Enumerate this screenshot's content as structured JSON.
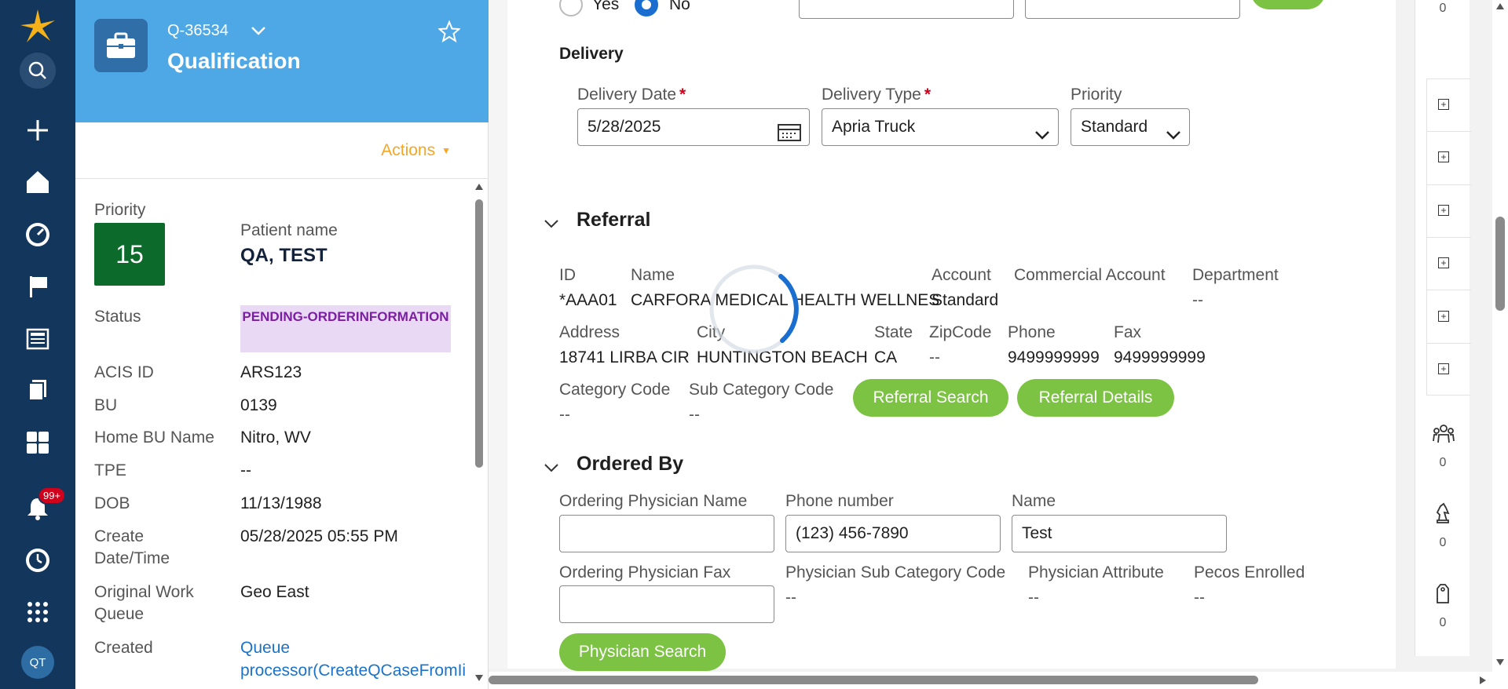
{
  "rail": {
    "notifications_badge": "99+",
    "avatar_initials": "QT",
    "icons": [
      "logo-icon",
      "search-icon",
      "plus-icon",
      "home-icon",
      "dashboard-icon",
      "flag-icon",
      "news-icon",
      "documents-icon",
      "apps-grid-icon",
      "bell-icon",
      "history-icon",
      "launcher-icon"
    ]
  },
  "case": {
    "id": "Q-36534",
    "title": "Qualification",
    "actions_label": "Actions",
    "fields": {
      "priority_label": "Priority",
      "priority_value": "15",
      "patient_name_label": "Patient name",
      "patient_name_value": "QA, TEST",
      "status_label": "Status",
      "status_value": "PENDING-ORDERINFORMATION",
      "acis_label": "ACIS ID",
      "acis_value": "ARS123",
      "bu_label": "BU",
      "bu_value": "0139",
      "home_bu_label": "Home BU Name",
      "home_bu_value": "Nitro, WV",
      "tpe_label": "TPE",
      "tpe_value": "--",
      "dob_label": "DOB",
      "dob_value": "11/13/1988",
      "create_label_1": "Create",
      "create_label_2": "Date/Time",
      "create_value": "05/28/2025 05:55 PM",
      "owq_label_1": "Original Work",
      "owq_label_2": "Queue",
      "owq_value": "Geo East",
      "created_label": "Created",
      "created_value_1": "Queue",
      "created_value_2": "processor(CreateQCaseFromIi"
    }
  },
  "main": {
    "radio_yes": "Yes",
    "radio_no": "No",
    "radio_selected": "No",
    "delivery": {
      "heading": "Delivery",
      "date_label": "Delivery Date",
      "date_value": "5/28/2025",
      "type_label": "Delivery Type",
      "type_value": "Apria Truck",
      "priority_label": "Priority",
      "priority_value": "Standard",
      "required_mark": "*"
    },
    "referral": {
      "heading": "Referral",
      "id_label": "ID",
      "id_value": "*AAA01",
      "name_label": "Name",
      "name_value": "CARFORA MEDICAL HEALTH WELLNES",
      "account_label": "Account",
      "account_value": "Standard",
      "commercial_label": "Commercial Account",
      "department_label": "Department",
      "department_value": "--",
      "address_label": "Address",
      "address_value": "18741 LIRBA CIR",
      "city_label": "City",
      "city_value": "HUNTINGTON BEACH",
      "state_label": "State",
      "state_value": "CA",
      "zip_label": "ZipCode",
      "zip_value": "--",
      "phone_label": "Phone",
      "phone_value": "9499999999",
      "fax_label": "Fax",
      "fax_value": "9499999999",
      "category_label": "Category Code",
      "category_value": "--",
      "subcategory_label": "Sub Category Code",
      "subcategory_value": "--",
      "search_button": "Referral Search",
      "details_button": "Referral Details"
    },
    "ordered_by": {
      "heading": "Ordered By",
      "physician_name_label": "Ordering Physician Name",
      "physician_name_value": "",
      "phone_label": "Phone number",
      "phone_value": "(123) 456-7890",
      "name_label": "Name",
      "name_value": "Test",
      "fax_label": "Ordering Physician Fax",
      "fax_value": "",
      "sub_cat_label": "Physician Sub Category Code",
      "sub_cat_value": "--",
      "attribute_label": "Physician Attribute",
      "attribute_value": "--",
      "pecos_label": "Pecos Enrolled",
      "pecos_value": "--",
      "search_button": "Physician Search"
    }
  },
  "utility": {
    "count_top": "0",
    "count_team": "0",
    "count_chess": "0",
    "count_tag": "0",
    "icons": [
      "expand-plus-icon",
      "team-icon",
      "chess-knight-icon",
      "tag-icon"
    ]
  },
  "colors": {
    "rail": "#13365c",
    "header": "#4ea8e6",
    "accent_green": "#7cc243",
    "priority_green": "#0c6b2b",
    "actions_orange": "#f5a623",
    "status_purple": "#7a1fa2",
    "required_red": "#d0021b",
    "link_blue": "#1a73c9"
  }
}
